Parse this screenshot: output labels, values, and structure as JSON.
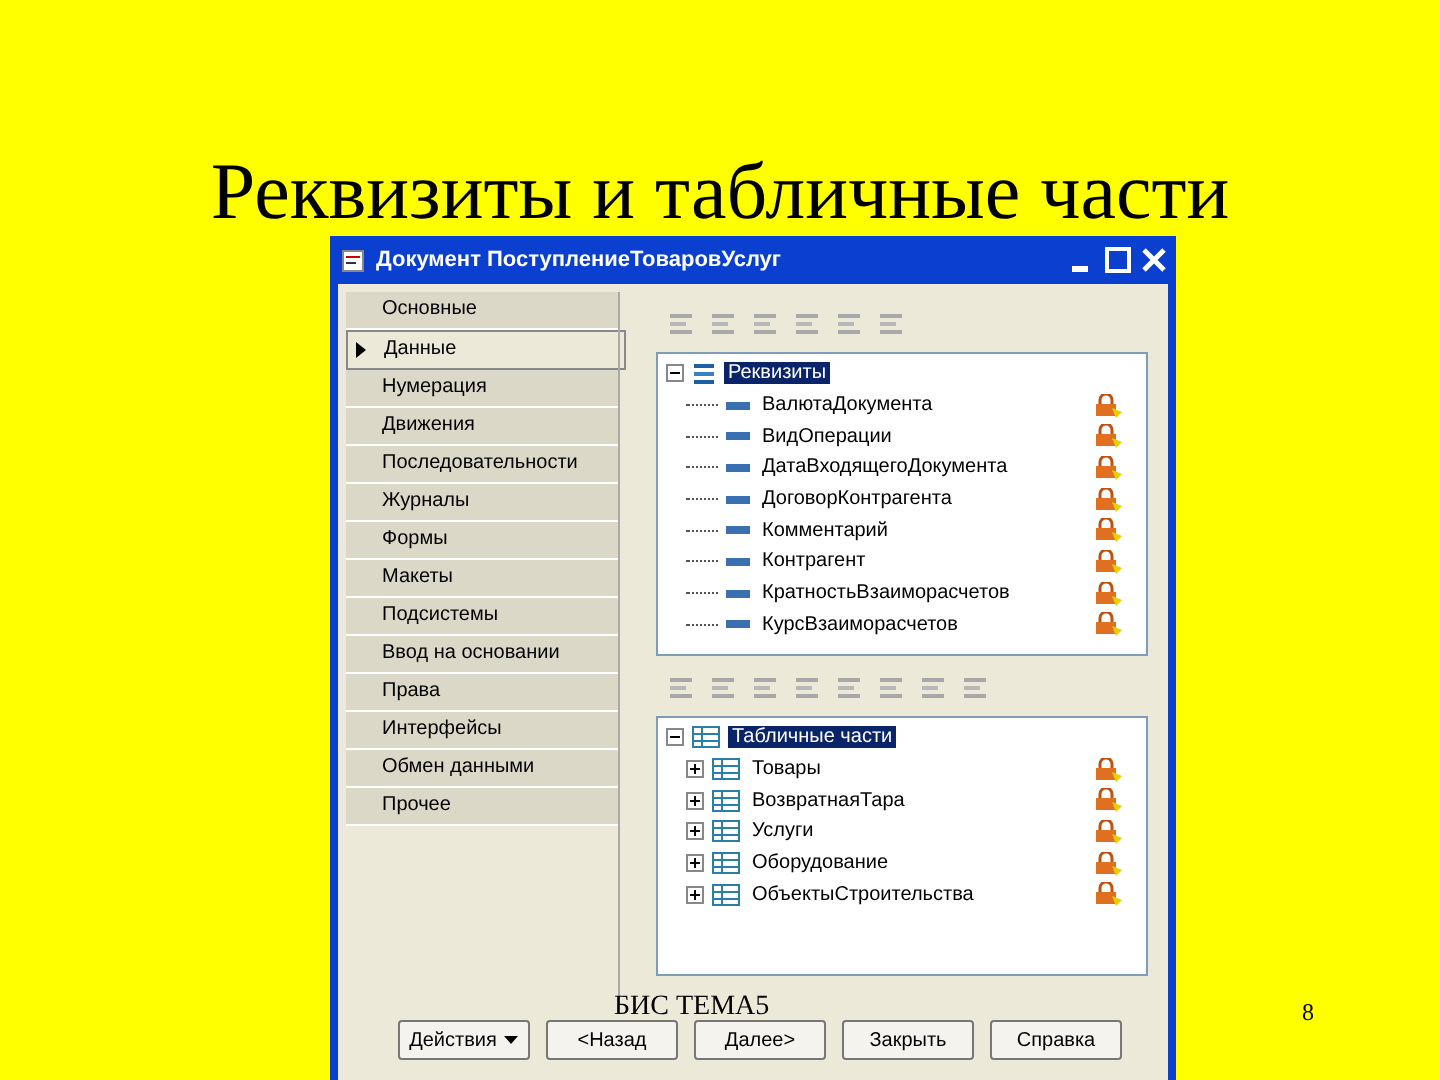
{
  "slide": {
    "title": "Реквизиты и табличные части",
    "footer": "БИС ТЕМА5",
    "page_number": "8"
  },
  "window": {
    "title": "Документ ПоступлениеТоваровУслуг"
  },
  "sidebar": {
    "items": [
      {
        "label": "Основные",
        "selected": false
      },
      {
        "label": "Данные",
        "selected": true
      },
      {
        "label": "Нумерация",
        "selected": false
      },
      {
        "label": "Движения",
        "selected": false
      },
      {
        "label": "Последовательности",
        "selected": false
      },
      {
        "label": "Журналы",
        "selected": false
      },
      {
        "label": "Формы",
        "selected": false
      },
      {
        "label": "Макеты",
        "selected": false
      },
      {
        "label": "Подсистемы",
        "selected": false
      },
      {
        "label": "Ввод на основании",
        "selected": false
      },
      {
        "label": "Права",
        "selected": false
      },
      {
        "label": "Интерфейсы",
        "selected": false
      },
      {
        "label": "Обмен данными",
        "selected": false
      },
      {
        "label": "Прочее",
        "selected": false
      }
    ]
  },
  "trees": [
    {
      "kind": "attribute",
      "root": {
        "label": "Реквизиты",
        "selected": true,
        "expanded": true
      },
      "children": [
        {
          "label": "ВалютаДокумента"
        },
        {
          "label": "ВидОперации"
        },
        {
          "label": "ДатаВходящегоДокумента"
        },
        {
          "label": "ДоговорКонтрагента"
        },
        {
          "label": "Комментарий"
        },
        {
          "label": "Контрагент"
        },
        {
          "label": "КратностьВзаиморасчетов"
        },
        {
          "label": "КурсВзаиморасчетов"
        }
      ]
    },
    {
      "kind": "table",
      "root": {
        "label": "Табличные части",
        "selected": true,
        "expanded": true
      },
      "children": [
        {
          "label": "Товары",
          "expanded": false
        },
        {
          "label": "ВозвратнаяТара",
          "expanded": false
        },
        {
          "label": "Услуги",
          "expanded": false
        },
        {
          "label": "Оборудование",
          "expanded": false
        },
        {
          "label": "ОбъектыСтроительства",
          "expanded": false
        }
      ]
    }
  ],
  "buttons": [
    {
      "label": "Действия",
      "kind": "menu"
    },
    {
      "label": "<Назад",
      "kind": "plain"
    },
    {
      "label": "Далее>",
      "kind": "plain"
    },
    {
      "label": "Закрыть",
      "kind": "plain"
    },
    {
      "label": "Справка",
      "kind": "plain"
    }
  ]
}
